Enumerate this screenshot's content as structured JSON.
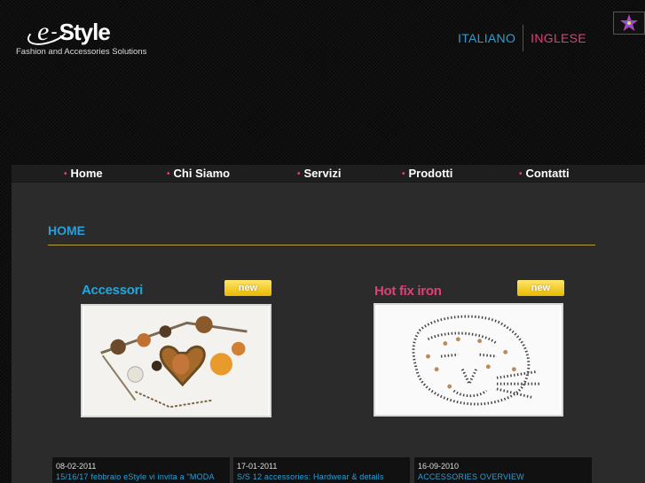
{
  "logo": {
    "e_letter": "e",
    "dash": "-",
    "word": "Style",
    "tagline": "Fashion and Accessories Solutions"
  },
  "language": {
    "italian": "ITALIANO",
    "english": "INGLESE"
  },
  "header_icon": "star-flower-icon",
  "nav": {
    "bullet": "•",
    "items": [
      {
        "label": "Home"
      },
      {
        "label": "Chi Siamo"
      },
      {
        "label": "Servizi"
      },
      {
        "label": "Prodotti"
      },
      {
        "label": "Contatti"
      }
    ]
  },
  "main": {
    "section_title": "HOME",
    "products": [
      {
        "title": "Accessori",
        "badge": "new",
        "image": "jewelry-charms-photo"
      },
      {
        "title": "Hot fix iron",
        "badge": "new",
        "image": "rhinestone-leopard-photo"
      }
    ]
  },
  "news": [
    {
      "date": "08-02-2011",
      "text": "15/16/17 febbraio eStyle vi invita a \"MODA"
    },
    {
      "date": "17-01-2011",
      "text": "S/S 12 accessories: Hardwear & details"
    },
    {
      "date": "16-09-2010",
      "text": "ACCESSORIES OVERVIEW"
    }
  ],
  "colors": {
    "accent_blue": "#2a9fd8",
    "accent_pink": "#e0407a",
    "badge_yellow": "#f2c400",
    "rule_gold": "#b8a03a"
  }
}
